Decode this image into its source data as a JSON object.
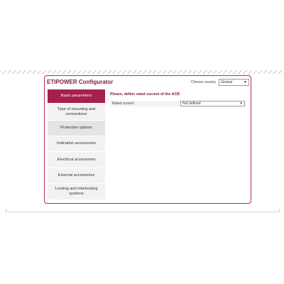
{
  "header": {
    "title": "ETIPOWER Configurator"
  },
  "country": {
    "label": "Choose country",
    "value": "Global"
  },
  "sidebar": {
    "items": [
      {
        "label": "Basic parameters"
      },
      {
        "label": "Type of mounting and connections"
      },
      {
        "label": "Protection options"
      },
      {
        "label": "Indication accessories"
      },
      {
        "label": "Electrical accessories"
      },
      {
        "label": "External accessories"
      },
      {
        "label": "Locking and interlocking systems"
      }
    ]
  },
  "main": {
    "prompt": "Please, define rated current of the ACB",
    "fields": [
      {
        "label": "Rated current",
        "value": "Not defined"
      }
    ]
  },
  "icons": {
    "dropdown": "chevron-down-icon"
  },
  "colors": {
    "accent": "#a61f51",
    "title": "#7a1c3f"
  }
}
